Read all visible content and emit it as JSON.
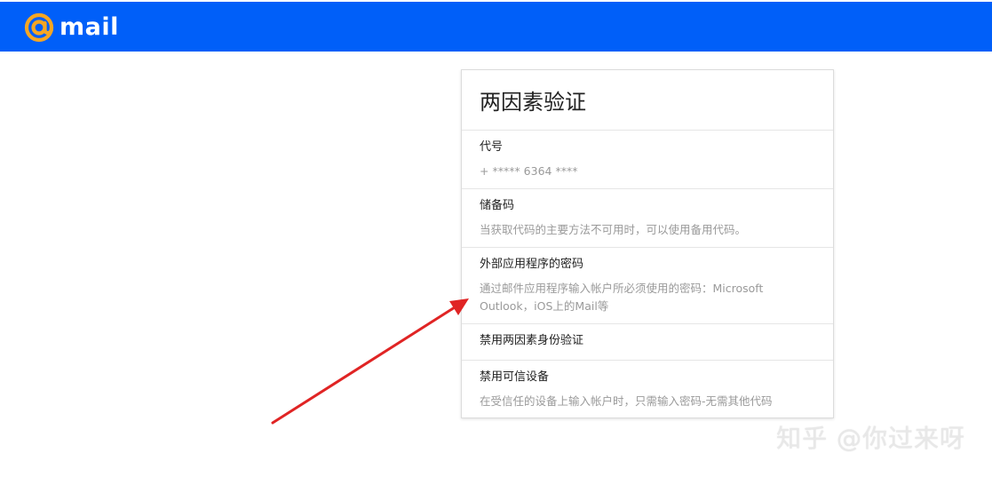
{
  "header": {
    "logo_text": "mail",
    "brand_color": "#005ff9",
    "logo_accent": "#f5a623"
  },
  "card": {
    "title": "两因素验证",
    "options": [
      {
        "title": "代号",
        "description": "+ ***** 6364 ****"
      },
      {
        "title": "储备码",
        "description": "当获取代码的主要方法不可用时，可以使用备用代码。"
      },
      {
        "title": "外部应用程序的密码",
        "description": "通过邮件应用程序输入帐户所必须使用的密码：Microsoft Outlook，iOS上的Mail等"
      },
      {
        "title": "禁用两因素身份验证"
      },
      {
        "title": "禁用可信设备",
        "description": "在受信任的设备上输入帐户时，只需输入密码-无需其他代码"
      }
    ]
  },
  "annotation": {
    "arrow_color": "#e02424"
  },
  "watermark": "知乎 @你过来呀"
}
